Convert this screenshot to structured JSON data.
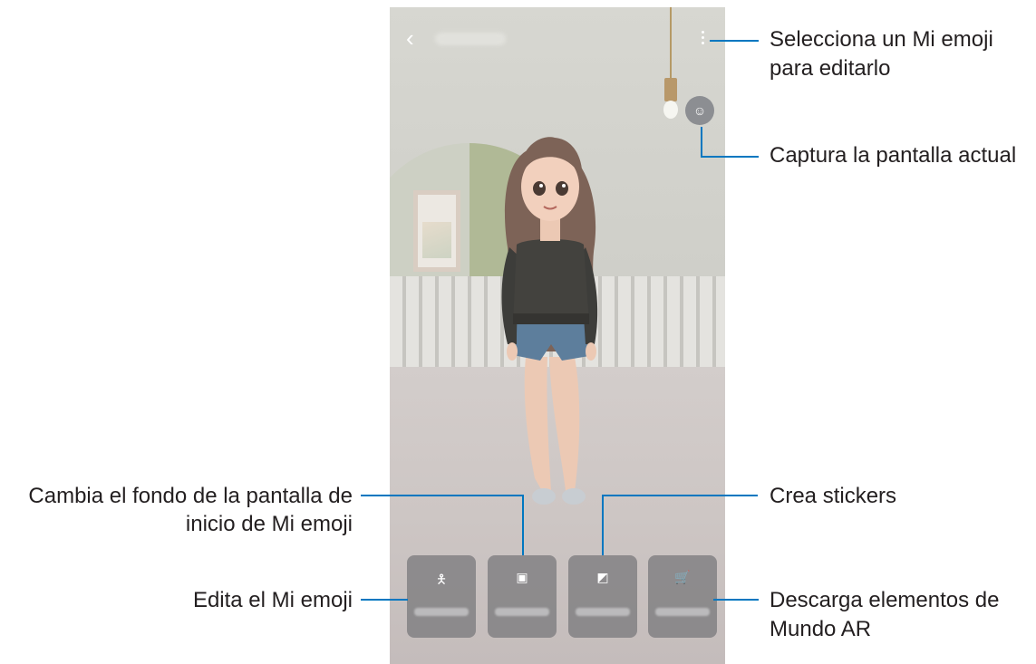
{
  "callouts": {
    "select_emoji": "Selecciona un Mi emoji\npara editarlo",
    "capture": "Captura la pantalla actual",
    "background_line1": "Cambia el fondo de la pantalla de",
    "background_line2": "inicio de Mi emoji",
    "stickers": "Crea stickers",
    "edit": "Edita el Mi emoji",
    "download_line1": "Descarga elementos de",
    "download_line2": "Mundo AR"
  },
  "screen": {
    "icons": [
      "back-icon",
      "more-options-icon",
      "capture-icon",
      "person-icon",
      "image-icon",
      "sticker-icon",
      "cart-icon"
    ],
    "colors": {
      "callout_line": "#0077c0",
      "button_bg": "#767678"
    }
  }
}
